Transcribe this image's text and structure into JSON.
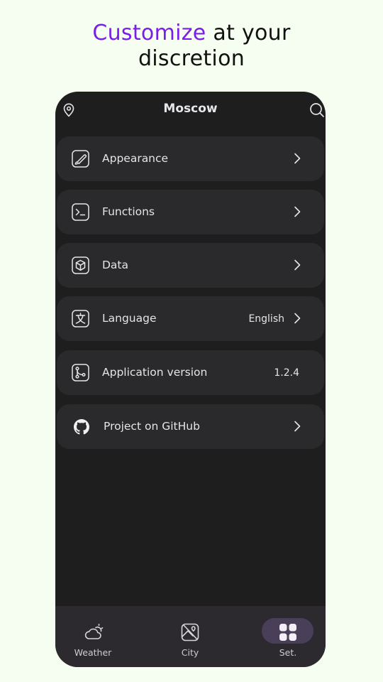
{
  "headline": {
    "accent": "Customize",
    "rest": " at your",
    "line2": "discretion"
  },
  "header": {
    "city": "Moscow",
    "left_icon": "map-pin-icon",
    "right_icon": "search-icon"
  },
  "settings": {
    "items": [
      {
        "icon": "brush-icon",
        "label": "Appearance",
        "value": "",
        "has_arrow": true
      },
      {
        "icon": "terminal-icon",
        "label": "Functions",
        "value": "",
        "has_arrow": true
      },
      {
        "icon": "cube-icon",
        "label": "Data",
        "value": "",
        "has_arrow": true
      },
      {
        "icon": "translate-icon",
        "label": "Language",
        "value": "English",
        "has_arrow": true
      },
      {
        "icon": "git-branch-icon",
        "label": "Application version",
        "value": "1.2.4",
        "has_arrow": false
      },
      {
        "icon": "github-icon",
        "label": "Project on GitHub",
        "value": "",
        "has_arrow": true
      }
    ]
  },
  "nav": {
    "items": [
      {
        "icon": "cloud-sun-icon",
        "label": "Weather",
        "active": false
      },
      {
        "icon": "map-image-icon",
        "label": "City",
        "active": false
      },
      {
        "icon": "grid-icon",
        "label": "Set.",
        "active": true
      }
    ]
  },
  "colors": {
    "accent": "#7a1ee6",
    "page_background": "#f6fdf1",
    "phone_background": "#1e1e1f",
    "card_background": "#2a292c",
    "nav_background": "#2c2a2f",
    "active_pill": "#4a3f59"
  }
}
